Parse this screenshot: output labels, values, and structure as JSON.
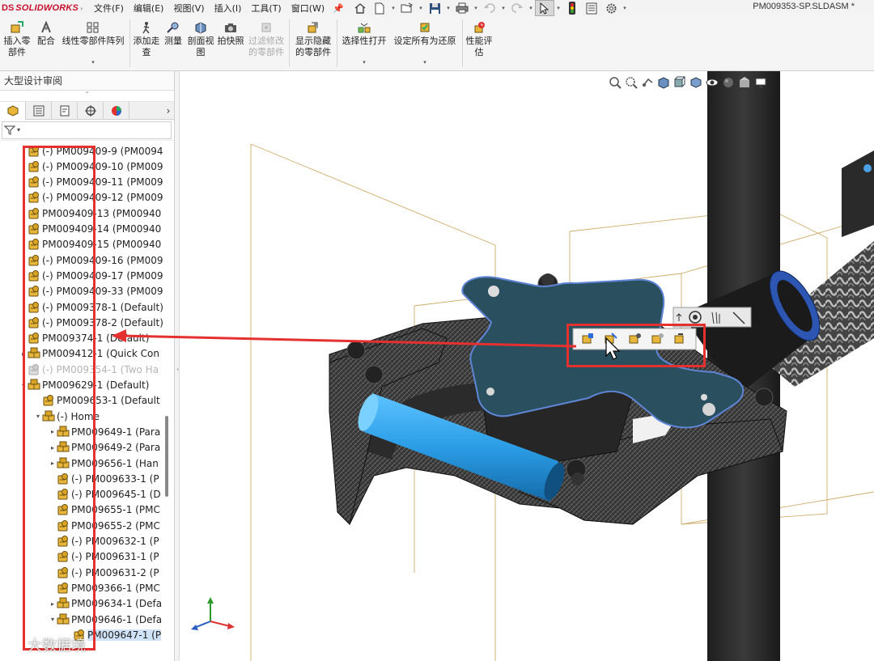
{
  "app": {
    "brand_prefix": "DS",
    "brand": "SOLIDWORKS",
    "document_title": "PM009353-SP.SLDASM *"
  },
  "menu": [
    "文件(F)",
    "编辑(E)",
    "视图(V)",
    "插入(I)",
    "工具(T)",
    "窗口(W)"
  ],
  "quick_access": [
    "home-icon",
    "new-icon",
    "open-icon",
    "save-icon",
    "print-icon",
    "undo-icon",
    "redo-icon",
    "select-icon",
    "rebuild-icon",
    "file-properties-icon",
    "options-icon"
  ],
  "ribbon": {
    "buttons": [
      {
        "label1": "插入零",
        "label2": "部件",
        "icon": "insert-component-icon",
        "dropdown": false,
        "enabled": true
      },
      {
        "label1": "配合",
        "label2": "",
        "icon": "mate-icon",
        "dropdown": false,
        "enabled": true
      },
      {
        "label1": "线性零部件阵列",
        "label2": "",
        "icon": "linear-pattern-icon",
        "dropdown": true,
        "enabled": true
      },
      {
        "label1": "添加走",
        "label2": "查",
        "icon": "walkthrough-icon",
        "dropdown": false,
        "enabled": true
      },
      {
        "label1": "测量",
        "label2": "",
        "icon": "measure-icon",
        "dropdown": false,
        "enabled": true
      },
      {
        "label1": "剖面视",
        "label2": "图",
        "icon": "section-view-icon",
        "dropdown": false,
        "enabled": true
      },
      {
        "label1": "拍快照",
        "label2": "",
        "icon": "snapshot-icon",
        "dropdown": false,
        "enabled": true
      },
      {
        "label1": "过滤修改",
        "label2": "的零部件",
        "icon": "filter-modified-icon",
        "dropdown": false,
        "enabled": false
      },
      {
        "label1": "显示隐藏",
        "label2": "的零部件",
        "icon": "show-hidden-icon",
        "dropdown": false,
        "enabled": true
      },
      {
        "label1": "选择性打开",
        "label2": "",
        "icon": "selective-open-icon",
        "dropdown": true,
        "enabled": true
      },
      {
        "label1": "设定所有为还原",
        "label2": "",
        "icon": "set-resolved-icon",
        "dropdown": true,
        "enabled": true
      },
      {
        "label1": "性能评",
        "label2": "估",
        "icon": "performance-icon",
        "dropdown": false,
        "enabled": true
      }
    ]
  },
  "left_panel": {
    "title": "大型设计审阅",
    "tabs": [
      "feature-manager-icon",
      "property-manager-icon",
      "configuration-manager-icon",
      "dimxpert-icon",
      "display-manager-icon"
    ],
    "tree": [
      {
        "label": "(-) PM009409-9 (PM0094",
        "level": 1,
        "expand": "",
        "state": "normal"
      },
      {
        "label": "(-) PM009409-10 (PM009",
        "level": 1,
        "expand": "",
        "state": "normal"
      },
      {
        "label": "(-) PM009409-11 (PM009",
        "level": 1,
        "expand": "",
        "state": "normal"
      },
      {
        "label": "(-) PM009409-12 (PM009",
        "level": 1,
        "expand": "",
        "state": "normal"
      },
      {
        "label": "PM009409-13 (PM00940",
        "level": 1,
        "expand": "",
        "state": "normal"
      },
      {
        "label": "PM009409-14 (PM00940",
        "level": 1,
        "expand": "",
        "state": "normal"
      },
      {
        "label": "PM009409-15 (PM00940",
        "level": 1,
        "expand": "",
        "state": "normal"
      },
      {
        "label": "(-) PM009409-16 (PM009",
        "level": 1,
        "expand": "",
        "state": "normal"
      },
      {
        "label": "(-) PM009409-17 (PM009",
        "level": 1,
        "expand": "",
        "state": "normal"
      },
      {
        "label": "(-) PM009409-33 (PM009",
        "level": 1,
        "expand": "",
        "state": "normal"
      },
      {
        "label": "(-) PM009378-1 (Default)",
        "level": 1,
        "expand": "",
        "state": "normal"
      },
      {
        "label": "(-) PM009378-2 (Default)",
        "level": 1,
        "expand": "",
        "state": "normal"
      },
      {
        "label": "PM009374-1 (Default)",
        "level": 1,
        "expand": "",
        "state": "normal"
      },
      {
        "label": "PM009412-1 (Quick Con",
        "level": 1,
        "expand": "▸",
        "state": "normal"
      },
      {
        "label": "(-) PM009354-1 (Two Ha",
        "level": 1,
        "expand": "",
        "state": "ghost"
      },
      {
        "label": "PM009629-1 (Default)",
        "level": 1,
        "expand": "▾",
        "state": "normal"
      },
      {
        "label": "PM009653-1 (Default",
        "level": 2,
        "expand": "",
        "state": "normal"
      },
      {
        "label": "(-) Home",
        "level": 2,
        "expand": "▾",
        "state": "normal"
      },
      {
        "label": "PM009649-1 (Para",
        "level": 3,
        "expand": "▸",
        "state": "normal"
      },
      {
        "label": "PM009649-2 (Para",
        "level": 3,
        "expand": "▸",
        "state": "normal"
      },
      {
        "label": "PM009656-1 (Han",
        "level": 3,
        "expand": "▸",
        "state": "normal"
      },
      {
        "label": "(-) PM009633-1 (P",
        "level": 3,
        "expand": "",
        "state": "normal"
      },
      {
        "label": "(-) PM009645-1 (D",
        "level": 3,
        "expand": "",
        "state": "normal"
      },
      {
        "label": "PM009655-1 (PMC",
        "level": 3,
        "expand": "",
        "state": "normal"
      },
      {
        "label": "PM009655-2 (PMC",
        "level": 3,
        "expand": "",
        "state": "normal"
      },
      {
        "label": "(-) PM009632-1 (P",
        "level": 3,
        "expand": "",
        "state": "normal"
      },
      {
        "label": "(-) PM009631-1 (P",
        "level": 3,
        "expand": "",
        "state": "normal"
      },
      {
        "label": "(-) PM009631-2 (P",
        "level": 3,
        "expand": "",
        "state": "normal"
      },
      {
        "label": "PM009366-1 (PMC",
        "level": 3,
        "expand": "",
        "state": "normal"
      },
      {
        "label": "PM009634-1 (Defa",
        "level": 3,
        "expand": "▸",
        "state": "normal"
      },
      {
        "label": "PM009646-1 (Defa",
        "level": 3,
        "expand": "▾",
        "state": "normal"
      },
      {
        "label": "PM009647-1 (P",
        "level": 4,
        "expand": "",
        "state": "selected"
      }
    ]
  },
  "viewport": {
    "heads_up_icons": [
      "zoom-to-fit-icon",
      "zoom-to-area-icon",
      "previous-view-icon",
      "section-view-icon",
      "view-orientation-icon",
      "display-style-icon",
      "hide-show-icon",
      "edit-appearance-icon",
      "apply-scene-icon",
      "view-settings-icon"
    ],
    "context_toolbar": [
      "component-icon-1",
      "component-icon-2",
      "component-icon-3",
      "component-icon-4",
      "component-icon-5"
    ],
    "context_toolbar_top": [
      "mate-arrow-icon",
      "circle-target-icon",
      "hand-icon",
      "line-icon"
    ],
    "triad": {
      "x": "X",
      "y": "Y",
      "z": "Z"
    }
  },
  "annotation": {
    "color": "#e53030"
  },
  "watermark": "大数据境"
}
